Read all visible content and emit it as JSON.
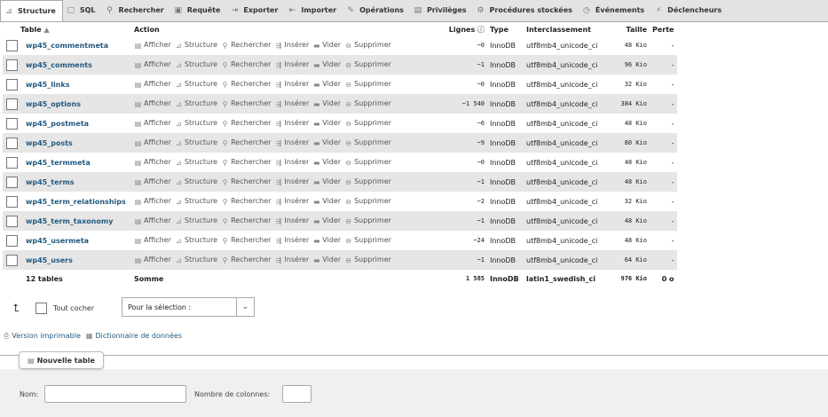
{
  "tabs": [
    {
      "label": "Structure",
      "icon": "structure-icon",
      "active": true
    },
    {
      "label": "SQL",
      "icon": "sql-icon"
    },
    {
      "label": "Rechercher",
      "icon": "search-icon"
    },
    {
      "label": "Requête",
      "icon": "query-icon"
    },
    {
      "label": "Exporter",
      "icon": "export-icon"
    },
    {
      "label": "Importer",
      "icon": "import-icon"
    },
    {
      "label": "Opérations",
      "icon": "operations-icon"
    },
    {
      "label": "Privilèges",
      "icon": "privileges-icon"
    },
    {
      "label": "Procédures stockées",
      "icon": "procedures-icon"
    },
    {
      "label": "Événements",
      "icon": "clock-icon"
    },
    {
      "label": "Déclencheurs",
      "icon": "triggers-icon"
    }
  ],
  "columns": {
    "table": "Table",
    "action": "Action",
    "rows": "Lignes",
    "type": "Type",
    "collation": "Interclassement",
    "size": "Taille",
    "overhead": "Perte"
  },
  "actions": {
    "browse": "Afficher",
    "structure": "Structure",
    "search": "Rechercher",
    "insert": "Insérer",
    "empty": "Vider",
    "drop": "Supprimer"
  },
  "rows": [
    {
      "name": "wp45_commentmeta",
      "rows": "~0",
      "engine": "InnoDB",
      "collation": "utf8mb4_unicode_ci",
      "size": "48 Kio",
      "overhead": "-"
    },
    {
      "name": "wp45_comments",
      "rows": "~1",
      "engine": "InnoDB",
      "collation": "utf8mb4_unicode_ci",
      "size": "96 Kio",
      "overhead": "-"
    },
    {
      "name": "wp45_links",
      "rows": "~0",
      "engine": "InnoDB",
      "collation": "utf8mb4_unicode_ci",
      "size": "32 Kio",
      "overhead": "-"
    },
    {
      "name": "wp45_options",
      "rows": "~1 540",
      "engine": "InnoDB",
      "collation": "utf8mb4_unicode_ci",
      "size": "384 Kio",
      "overhead": "-"
    },
    {
      "name": "wp45_postmeta",
      "rows": "~6",
      "engine": "InnoDB",
      "collation": "utf8mb4_unicode_ci",
      "size": "48 Kio",
      "overhead": "-"
    },
    {
      "name": "wp45_posts",
      "rows": "~9",
      "engine": "InnoDB",
      "collation": "utf8mb4_unicode_ci",
      "size": "80 Kio",
      "overhead": "-"
    },
    {
      "name": "wp45_termmeta",
      "rows": "~0",
      "engine": "InnoDB",
      "collation": "utf8mb4_unicode_ci",
      "size": "48 Kio",
      "overhead": "-"
    },
    {
      "name": "wp45_terms",
      "rows": "~1",
      "engine": "InnoDB",
      "collation": "utf8mb4_unicode_ci",
      "size": "48 Kio",
      "overhead": "-"
    },
    {
      "name": "wp45_term_relationships",
      "rows": "~2",
      "engine": "InnoDB",
      "collation": "utf8mb4_unicode_ci",
      "size": "32 Kio",
      "overhead": "-"
    },
    {
      "name": "wp45_term_taxonomy",
      "rows": "~1",
      "engine": "InnoDB",
      "collation": "utf8mb4_unicode_ci",
      "size": "48 Kio",
      "overhead": "-"
    },
    {
      "name": "wp45_usermeta",
      "rows": "~24",
      "engine": "InnoDB",
      "collation": "utf8mb4_unicode_ci",
      "size": "48 Kio",
      "overhead": "-"
    },
    {
      "name": "wp45_users",
      "rows": "~1",
      "engine": "InnoDB",
      "collation": "utf8mb4_unicode_ci",
      "size": "64 Kio",
      "overhead": "-"
    }
  ],
  "footer": {
    "count": "12 tables",
    "label": "Somme",
    "rows": "1 585",
    "engine": "InnoDB",
    "collation": "latin1_swedish_ci",
    "size": "976 Kio",
    "overhead": "0 o"
  },
  "bulk": {
    "check_all": "Tout cocher",
    "select_value": "Pour la sélection :"
  },
  "links": {
    "print": "Version imprimable",
    "dictionary": "Dictionnaire de données"
  },
  "new_table": {
    "button": "Nouvelle table",
    "name_label": "Nom:",
    "name_value": "",
    "columns_label": "Nombre de colonnes:",
    "columns_value": ""
  },
  "colors": {
    "link": "#235a81",
    "row_alt": "#e6e6e6",
    "tabbar": "#e3e3e3"
  }
}
